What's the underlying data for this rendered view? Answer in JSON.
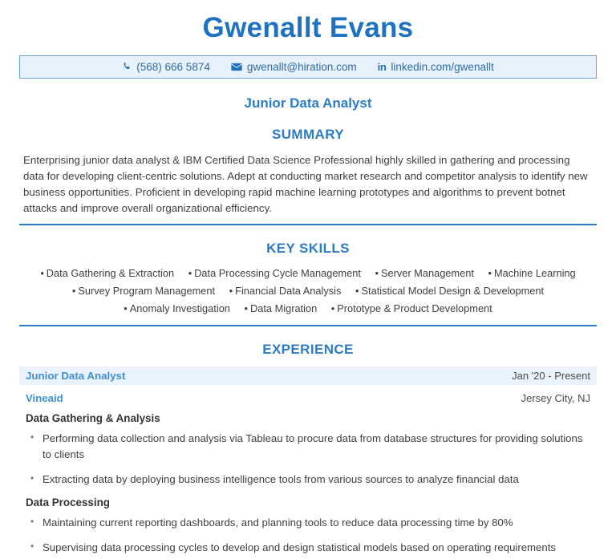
{
  "header": {
    "name": "Gwenallt Evans",
    "contacts": [
      {
        "icon": "phone-icon",
        "text": "(568) 666 5874"
      },
      {
        "icon": "envelope-icon",
        "text": "gwenallt@hiration.com"
      },
      {
        "icon": "linkedin-icon",
        "text": "linkedin.com/gwenallt"
      }
    ],
    "job_title": "Junior Data Analyst"
  },
  "colors": {
    "accent": "#2b7cc4",
    "name": "#1f72c0",
    "band": "#eaf2fb",
    "contact_bar": "#e8f1fa",
    "contact_border": "#6aa7d8",
    "link": "#3f8fd4",
    "body_text": "#3f3f3f"
  },
  "summary": {
    "heading": "SUMMARY",
    "text": "Enterprising junior data analyst & IBM Certified Data Science Professional highly skilled in gathering and processing data for developing client-centric solutions. Adept at conducting market research and competitor analysis to identify new business opportunities. Proficient in developing rapid machine learning prototypes and algorithms to prevent botnet attacks and improve overall organizational efficiency."
  },
  "key_skills": {
    "heading": "KEY SKILLS",
    "rows": [
      [
        "Data Gathering & Extraction",
        "Data Processing Cycle Management",
        "Server Management",
        "Machine Learning"
      ],
      [
        "Survey Program Management",
        "Financial Data Analysis",
        "Statistical Model Design & Development"
      ],
      [
        "Anomaly Investigation",
        "Data Migration",
        "Prototype & Product Development"
      ]
    ]
  },
  "experience": {
    "heading": "EXPERIENCE",
    "entries": [
      {
        "role": "Junior Data Analyst",
        "date": "Jan '20 - Present",
        "company": "Vineaid",
        "location": "Jersey City, NJ",
        "groups": [
          {
            "subhead": "Data Gathering & Analysis",
            "bullets": [
              "Performing data collection and analysis via Tableau to procure data from database structures for providing solutions to clients",
              "Extracting data by deploying business intelligence tools from various sources to analyze financial data"
            ]
          },
          {
            "subhead": "Data Processing",
            "bullets": [
              "Maintaining current reporting dashboards, and planning tools to reduce data processing time by 80%",
              "Supervising data processing cycles to develop and design statistical models based on operating requirements"
            ]
          }
        ]
      }
    ]
  }
}
